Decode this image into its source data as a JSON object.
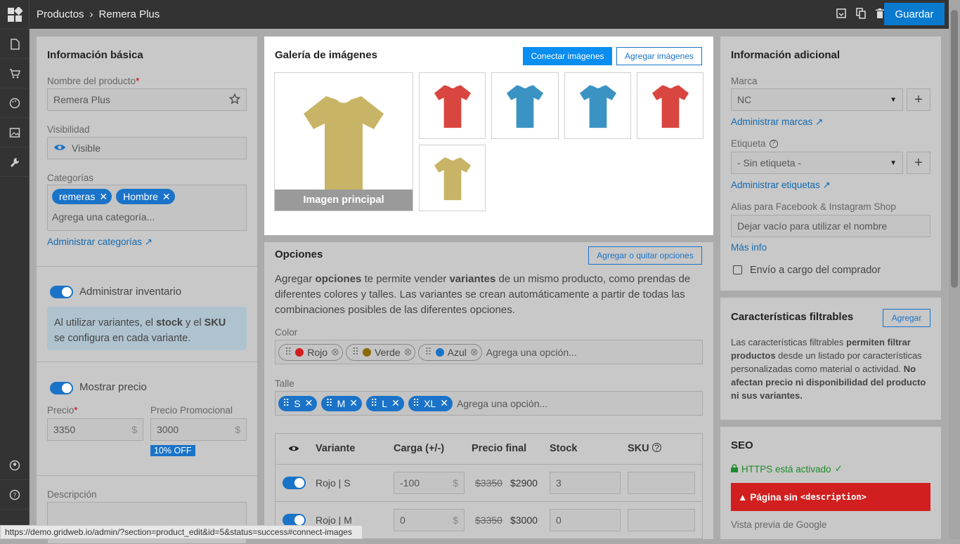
{
  "breadcrumb": {
    "section": "Productos",
    "separator": "›",
    "current": "Remera Plus"
  },
  "toolbar": {
    "save_label": "Guardar"
  },
  "basic": {
    "title": "Información básica",
    "name_label": "Nombre del producto",
    "required": "*",
    "name_value": "Remera Plus",
    "visibility_label": "Visibilidad",
    "visibility_value": "Visible",
    "categories_label": "Categorías",
    "categories": [
      "remeras",
      "Hombre"
    ],
    "categories_placeholder": "Agrega una categoría...",
    "categories_link": "Administrar categorías ↗"
  },
  "inventory": {
    "toggle_label": "Administrar inventario",
    "info_1": "Al utilizar variantes, el ",
    "info_stock": "stock",
    "info_2": " y el ",
    "info_sku": "SKU",
    "info_3": "se configura en cada variante."
  },
  "price": {
    "toggle_label": "Mostrar precio",
    "price_label": "Precio",
    "required": "*",
    "price_value": "3350",
    "promo_label": "Precio Promocional",
    "promo_value": "3000",
    "currency": "$",
    "discount": "10% OFF",
    "description_label": "Descripción"
  },
  "gallery": {
    "title": "Galería de imágenes",
    "connect_label": "Conectar imágenes",
    "add_label": "Agregar imágenes",
    "main_caption": "Imagen principal"
  },
  "options": {
    "title": "Opciones",
    "button": "Agregar o quitar opciones",
    "d1": "Agregar ",
    "d_opciones": "opciones",
    "d2": " te permite vender ",
    "d_variantes": "variantes",
    "d3": " de un mismo producto, como prendas de",
    "d4": "diferentes colores y talles. Las variantes se crean automáticamente a partir de todas las",
    "d5": "combinaciones posibles de las diferentes opciones.",
    "color_label": "Color",
    "colors": [
      {
        "name": "Rojo",
        "hex": "#d11f1f"
      },
      {
        "name": "Verde",
        "hex": "#8a6a00"
      },
      {
        "name": "Azul",
        "hex": "#1a73c8"
      }
    ],
    "add_option": "Agrega una opción...",
    "size_label": "Talle",
    "sizes": [
      "S",
      "M",
      "L",
      "XL"
    ]
  },
  "variants": {
    "headers": {
      "variant": "Variante",
      "load": "Carga (+/-)",
      "final": "Precio final",
      "stock": "Stock",
      "sku": "SKU"
    },
    "rows": [
      {
        "name": "Rojo | S",
        "load": "-100",
        "old": "$3350",
        "new": "$2900",
        "stock": "3"
      },
      {
        "name": "Rojo | M",
        "load": "0",
        "old": "$3350",
        "new": "$3000",
        "stock": "0"
      }
    ]
  },
  "additional": {
    "title": "Información adicional",
    "brand_label": "Marca",
    "brand_value": "NC",
    "brand_link": "Administrar marcas ↗",
    "tag_label": "Etiqueta",
    "tag_value": "- Sin etiqueta -",
    "tag_link": "Administrar etiquetas ↗",
    "alias_label": "Alias para Facebook & Instagram Shop",
    "alias_placeholder": "Dejar vacío para utilizar el nombre",
    "more_info": "Más info",
    "shipping_label": "Envío a cargo del comprador"
  },
  "filters": {
    "title": "Características filtrables",
    "button": "Agregar",
    "t1": "Las características filtrables ",
    "t1b": "permiten filtrar",
    "t2b": "productos",
    "t2": " desde un listado por características",
    "t3": "personalizadas como material o actividad. ",
    "t3b": "No",
    "t4b": "afectan precio ni disponibilidad del producto",
    "t5b": "ni sus variantes."
  },
  "seo": {
    "title": "SEO",
    "https": "HTTPS está activado",
    "alert_1": "Página sin ",
    "alert_code": "<description>",
    "preview": "Vista previa de Google"
  },
  "status_url": "https://demo.gridweb.io/admin/?section=product_edit&id=5&status=success#connect-images",
  "colors": {
    "accent": "#1a73c8",
    "alert": "#d11f1f",
    "ok": "#1e8a2e"
  }
}
